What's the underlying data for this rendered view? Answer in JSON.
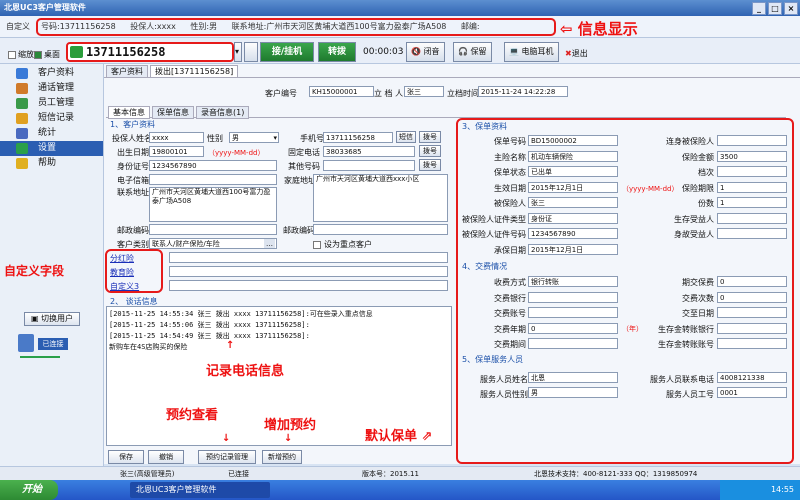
{
  "window": {
    "title": "北恩UC3客户管理软件"
  },
  "info": {
    "custom": "自定义",
    "phone": "号码:13711156258",
    "insured": "投保人:xxxx",
    "gender": "性别:男",
    "address": "联系地址:广州市天河区黄埔大道西100号富力盈泰广场A508",
    "email": "邮编:"
  },
  "annotations": {
    "info": "信息显示",
    "custom_fields": "自定义字段",
    "call_info": "记录电话信息",
    "appointment_view": "预约查看",
    "add_appointment": "增加预约",
    "default_policy": "默认保单"
  },
  "dialbar": {
    "minimize": "缩放",
    "desktop": "桌面",
    "phone_number": "13711156258",
    "hangup": "接/挂机",
    "transfer": "转拨",
    "timer": "00:00:03",
    "mute": "闭音",
    "hold": "保留",
    "headset": "电脑耳机",
    "exit": "退出"
  },
  "sidebar": {
    "items": [
      {
        "label": "客户资料",
        "color": "#3a7ad8"
      },
      {
        "label": "通话管理",
        "color": "#d07a2a"
      },
      {
        "label": "员工管理",
        "color": "#3a9a4a"
      },
      {
        "label": "短信记录",
        "color": "#e0a020"
      },
      {
        "label": "统计",
        "color": "#4a6ac0"
      },
      {
        "label": "设置",
        "color": "#2ba04a"
      },
      {
        "label": "帮助",
        "color": "#e0b020"
      }
    ],
    "switch_user": "切换用户",
    "connected": "已连接"
  },
  "doc_tabs": [
    "客户资料",
    "拨出[13711156258]"
  ],
  "header": {
    "customer_no_label": "客户编号",
    "customer_no": "KH15000001",
    "filer_label": "立 档 人",
    "filer": "张三",
    "file_time_label": "立档时间",
    "file_time": "2015-11-24 14:22:28"
  },
  "inner_tabs": [
    "基本信息",
    "保单信息",
    "录音信息(1)"
  ],
  "customer": {
    "section": "1、客户资料",
    "name_label": "投保人姓名",
    "name": "xxxx",
    "gender_label": "性别",
    "gender": "男",
    "mobile_label": "手机号",
    "mobile": "13711156258",
    "sms": "短信",
    "dial": "拨号",
    "birth_label": "出生日期",
    "birth": "19800101",
    "birth_hint": "（yyyy-MM-dd）",
    "landline_label": "固定电话",
    "landline": "38033685",
    "id_label": "身份证号",
    "id": "1234567890",
    "other_label": "其他号码",
    "email_label": "电子信箱",
    "home_label": "家庭地址",
    "home": "广州市天河区黄埔大道西xxx小区",
    "addr_label": "联系地址",
    "addr": "广州市天河区黄埔大道西100号富力盈泰广场A508",
    "zip_label": "邮政编码",
    "zip2_label": "邮政编码",
    "category_label": "客户类别",
    "category": "联系人/财产保险/车险",
    "key_label": "设为重点客户",
    "custom_fields": [
      "分红险",
      "教育险",
      "自定义3"
    ]
  },
  "call": {
    "section": "2、 谈话信息",
    "lines": [
      "[2015-11-25 14:55:34 张三 拨出 xxxx 13711156258]:可在些录入重点信息",
      "[2015-11-25 14:55:06 张三 拨出 xxxx 13711156258]:",
      "[2015-11-25 14:54:49 张三 拨出 xxxx 13711156258]:",
      "新购车在4S店购买的保险"
    ]
  },
  "buttons": {
    "save": "保存",
    "undo": "撤销",
    "appointment": "预约记录管理",
    "new_appointment": "新增预约"
  },
  "policy": {
    "section": "3、保单资料",
    "rows": [
      {
        "l1": "保单号码",
        "v1": "BD15000002",
        "l2": "连身被保险人",
        "v2": ""
      },
      {
        "l1": "主险名称",
        "v1": "机动车辆保险",
        "l2": "保险金额",
        "v2": "3500"
      },
      {
        "l1": "保单状态",
        "v1": "已出单",
        "l2": "档次",
        "v2": ""
      },
      {
        "l1": "生效日期",
        "v1": "2015年12月1日",
        "l2": "保险期限",
        "v2": "1"
      },
      {
        "l1": "被保险人",
        "v1": "张三",
        "l2": "份数",
        "v2": "1"
      },
      {
        "l1": "被保险人证件类型",
        "v1": "身份证",
        "l2": "生存受益人",
        "v2": ""
      },
      {
        "l1": "被保险人证件号码",
        "v1": "1234567890",
        "l2": "身故受益人",
        "v2": ""
      },
      {
        "l1": "承保日期",
        "v1": "2015年12月1日",
        "l2": "",
        "v2": ""
      }
    ],
    "hint": "（yyyy-MM-dd）"
  },
  "payment": {
    "section": "4、交费情况",
    "rows": [
      {
        "l1": "收费方式",
        "v1": "银行转账",
        "l2": "期交保费",
        "v2": "0"
      },
      {
        "l1": "交费银行",
        "v1": "",
        "l2": "交费次数",
        "v2": "0"
      },
      {
        "l1": "交费账号",
        "v1": "",
        "l2": "交至日期",
        "v2": ""
      },
      {
        "l1": "交费年期",
        "v1": "0",
        "l2": "生存金转账银行",
        "v2": ""
      },
      {
        "l1": "交费期间",
        "v1": "",
        "l2": "生存金转账账号",
        "v2": ""
      }
    ],
    "year": "（年）"
  },
  "agent": {
    "section": "5、保单服务人员",
    "name_label": "服务人员姓名",
    "name": "北恩",
    "phone_label": "服务人员联系电话",
    "phone": "4008121338",
    "gender_label": "服务人员性别",
    "gender": "男",
    "no_label": "服务人员工号",
    "no": "0001"
  },
  "status": {
    "user": "张三(高级管理员)",
    "connected": "已连接",
    "version": "版本号：2015.11",
    "support": "北恩技术支持：400-8121-333 QQ：1319850974"
  },
  "taskbar": {
    "start": "开始",
    "app": "北恩UC3客户管理软件",
    "time": "14:55"
  }
}
